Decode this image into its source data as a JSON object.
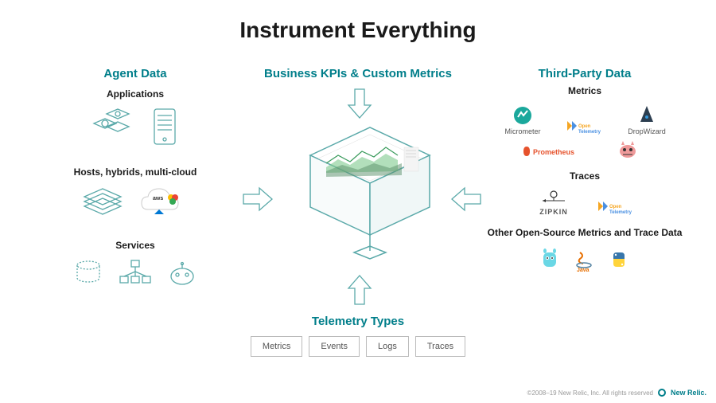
{
  "title": "Instrument Everything",
  "left": {
    "heading": "Agent Data",
    "sections": [
      {
        "label": "Applications"
      },
      {
        "label": "Hosts, hybrids, multi-cloud"
      },
      {
        "label": "Services"
      }
    ]
  },
  "center_top": {
    "heading": "Business KPIs & Custom Metrics"
  },
  "right": {
    "heading": "Third-Party Data",
    "metrics": {
      "label": "Metrics",
      "items": [
        {
          "name": "Micrometer"
        },
        {
          "name": "OpenTelemetry"
        },
        {
          "name": "DropWizard"
        },
        {
          "name": "Prometheus"
        },
        {
          "name": "Jaeger"
        }
      ]
    },
    "traces": {
      "label": "Traces",
      "items": [
        {
          "name": "ZIPKIN"
        },
        {
          "name": "OpenTelemetry"
        }
      ]
    },
    "other": {
      "label": "Other Open-Source Metrics and Trace Data",
      "items": [
        {
          "name": "Go"
        },
        {
          "name": "Java"
        },
        {
          "name": "Python"
        }
      ]
    }
  },
  "telemetry": {
    "heading": "Telemetry Types",
    "types": [
      "Metrics",
      "Events",
      "Logs",
      "Traces"
    ]
  },
  "footer": {
    "copyright": "©2008–19 New Relic, Inc. All rights reserved",
    "brand": "New Relic."
  },
  "colors": {
    "teal": "#007e8a",
    "stroke": "#5aa9a9"
  }
}
